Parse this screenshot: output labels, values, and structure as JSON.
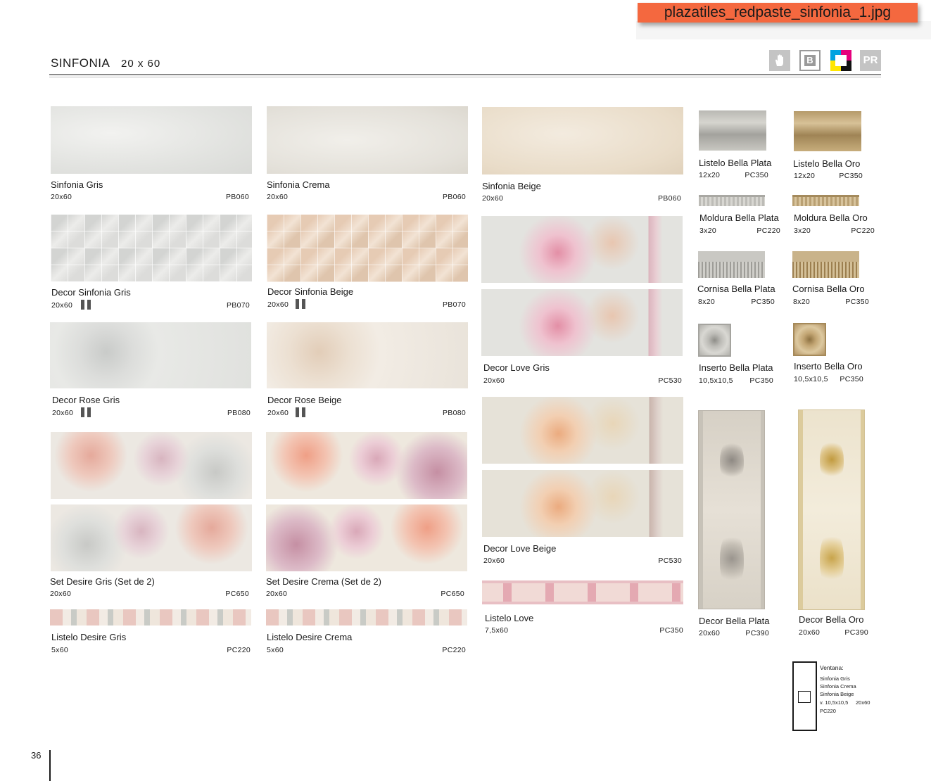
{
  "filename_tag": "plazatiles_redpaste_sinfonia_1.jpg",
  "header": {
    "title": "SINFONIA",
    "size": "20 x 60",
    "icons": [
      "hand-icon",
      "b-icon",
      "cmyk-icon",
      "pr-icon"
    ],
    "pr_label": "PR",
    "b_label": "B"
  },
  "column1": [
    {
      "name": "Sinfonia Gris",
      "size": "20x60",
      "code": "PB060"
    },
    {
      "name": "Decor Sinfonia Gris",
      "size": "20x60",
      "code": "PB070"
    },
    {
      "name": "Decor Rose Gris",
      "size": "20x60",
      "code": "PB080"
    },
    {
      "name": "Set Desire Gris (Set de 2)",
      "size": "20x60",
      "code": "PC650"
    },
    {
      "name": "Listelo Desire Gris",
      "size": "5x60",
      "code": "PC220"
    }
  ],
  "column2": [
    {
      "name": "Sinfonia Crema",
      "size": "20x60",
      "code": "PB060"
    },
    {
      "name": "Decor Sinfonia Beige",
      "size": "20x60",
      "code": "PB070"
    },
    {
      "name": "Decor Rose Beige",
      "size": "20x60",
      "code": "PB080"
    },
    {
      "name": "Set Desire Crema (Set de 2)",
      "size": "20x60",
      "code": "PC650"
    },
    {
      "name": "Listelo Desire Crema",
      "size": "5x60",
      "code": "PC220"
    }
  ],
  "column3": [
    {
      "name": "Sinfonia Beige",
      "size": "20x60",
      "code": "PB060"
    },
    {
      "name": "Decor Love Gris",
      "size": "20x60",
      "code": "PC530"
    },
    {
      "name": "Decor Love Beige",
      "size": "20x60",
      "code": "PC530"
    },
    {
      "name": "Listelo Love",
      "size": "7,5x60",
      "code": "PC350"
    }
  ],
  "accessories_plata": [
    {
      "name": "Listelo Bella Plata",
      "size": "12x20",
      "code": "PC350"
    },
    {
      "name": "Moldura Bella Plata",
      "size": "3x20",
      "code": "PC220"
    },
    {
      "name": "Cornisa Bella Plata",
      "size": "8x20",
      "code": "PC350"
    },
    {
      "name": "Inserto Bella Plata",
      "size": "10,5x10,5",
      "code": "PC350"
    },
    {
      "name": "Decor Bella Plata",
      "size": "20x60",
      "code": "PC390"
    }
  ],
  "accessories_oro": [
    {
      "name": "Listelo Bella Oro",
      "size": "12x20",
      "code": "PC350"
    },
    {
      "name": "Moldura Bella Oro",
      "size": "3x20",
      "code": "PC220"
    },
    {
      "name": "Cornisa Bella Oro",
      "size": "8x20",
      "code": "PC350"
    },
    {
      "name": "Inserto Bella Oro",
      "size": "10,5x10,5",
      "code": "PC350"
    },
    {
      "name": "Decor Bella Oro",
      "size": "20x60",
      "code": "PC390"
    }
  ],
  "ventana": {
    "title": "Ventana:",
    "lines": [
      "Sinfonia Gris",
      "Sinfonia Crema",
      "Sinfonia Beige"
    ],
    "size_line": "v. 10,5x10,5",
    "size_line2": "20x60",
    "code": "PC220"
  },
  "page_number": "36",
  "colors": {
    "filename_tag_bg": "#f4683f",
    "rule": "#8a8a8a",
    "icon_grey": "#c4c4c4"
  }
}
